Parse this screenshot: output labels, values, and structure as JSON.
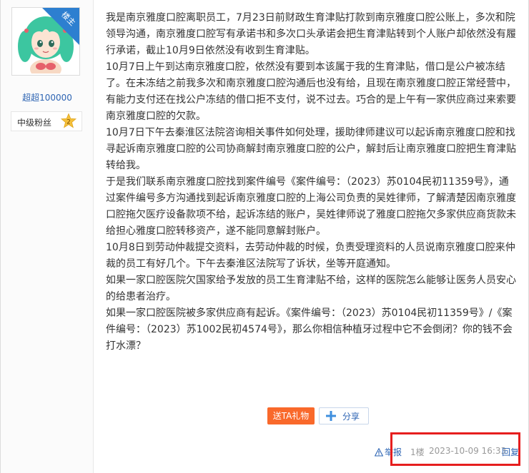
{
  "author": {
    "badge_text": "楼主",
    "username": "超超100000",
    "level_label": "中级粉丝",
    "level_number": "2"
  },
  "post": {
    "paragraphs": [
      "我是南京雅度口腔离职员工，7月23日前财政生育津贴打款到南京雅度口腔公账上，多次和院领导沟通，南京雅度口腔写有承诺书和多次口头承诺会把生育津贴转到个人账户却依然没有履行承诺，截止10月9日依然没有收到生育津贴。",
      "10月7日上午到达南京雅度口腔，依然没有要到本该属于我的生育津贴，借口是公户被冻结了。在未冻结之前我多次和南京雅度口腔沟通后也没有给，且现在南京雅度口腔正常经营中，有能力支付还在找公户冻结的借口拒不支付，说不过去。巧合的是上午有一家供应商过来索要南京雅度口腔的欠款。",
      "10月7日下午去秦淮区法院咨询相关事件如何处理，援助律师建议可以起诉南京雅度口腔和找寻起诉南京雅度口腔的公司协商解封南京雅度口腔的公户，解封后让南京雅度口腔把生育津贴转给我。",
      "于是我们联系南京雅度口腔找到案件编号《案件编号：（2023）苏0104民初11359号》，通过案件编号多方沟通找到起诉南京雅度口腔的上海公司负责的吴姓律师，了解清楚因南京雅度口腔拖欠医疗设备款项不给，起诉冻结的账户，吴姓律师说了雅度口腔拖欠多家供应商货款未给担心雅度口腔转移资产，遂不能同意解封账户。",
      "10月8日到劳动仲裁提交资料，去劳动仲裁的时候，负责受理资料的人员说南京雅度口腔来仲裁的员工有好几个。下午去秦淮区法院写了诉状，坐等开庭通知。",
      "如果一家口腔医院欠国家给予发放的员工生育津贴不给，这样的医院怎么能够让医务人员安心的给患者治疗。",
      "如果一家口腔医院被多家供应商有起诉。《案件编号：（2023）苏0104民初11359号》/《案件编号：（2023）苏1002民初4574号》，那么你相信种植牙过程中它不会倒闭？你的钱不会打水漂？"
    ]
  },
  "actions": {
    "gift_label": "送TA礼物",
    "share_label": "分享"
  },
  "footer": {
    "report_label": "举报",
    "floor": "1楼",
    "timestamp": "2023-10-09 16:33",
    "reply_label": "回复"
  },
  "colors": {
    "link_blue": "#2d64b3",
    "badge_blue": "#2d7fd0",
    "gift_orange": "#f9692b",
    "highlight_red": "#e61e1e",
    "meta_gray": "#999999"
  },
  "icons": {
    "avatar": "anime-girl-avatar",
    "level": "star-level-icon",
    "share": "plus-share-icon",
    "report": "warning-triangle-icon"
  }
}
